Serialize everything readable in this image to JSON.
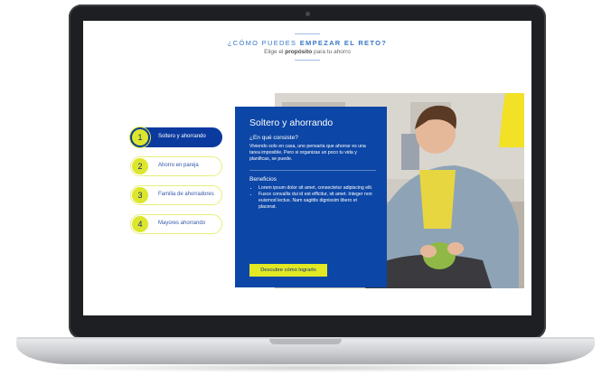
{
  "header": {
    "title_part1": "¿CÓMO PUEDES",
    "title_part2": "EMPEZAR EL RETO?",
    "subtitle_pre": "Elige el",
    "subtitle_bold": "propósito",
    "subtitle_post": "para tu ahorro"
  },
  "steps": [
    {
      "number": "1",
      "label": "Soltero y ahorrando",
      "active": true
    },
    {
      "number": "2",
      "label": "Ahorro en pareja",
      "active": false
    },
    {
      "number": "3",
      "label": "Familia de ahorradores",
      "active": false
    },
    {
      "number": "4",
      "label": "Mayores ahorrando",
      "active": false
    }
  ],
  "panel": {
    "title": "Soltero y ahorrando",
    "question": "¿En qué consiste?",
    "description": "Viviendo solo en casa, uno pensaría que ahorrar es una tarea imposible. Pero si organizas un poco tu vida y planificas, se puede.",
    "benefits_title": "Beneficios",
    "benefits": [
      "Lorem ipsum dolor sit amet, consectetur adipiscing elit.",
      "Fusce convallis dui id est efficitur, sit amet. Integer non euismod lectus. Nam sagittis dignissim libero et placerat."
    ],
    "cta_label": "Descubre cómo lograrlo"
  },
  "colors": {
    "panel_blue": "#0c46a6",
    "accent_yellow": "#e2e923",
    "link_blue": "#3a77c6"
  }
}
